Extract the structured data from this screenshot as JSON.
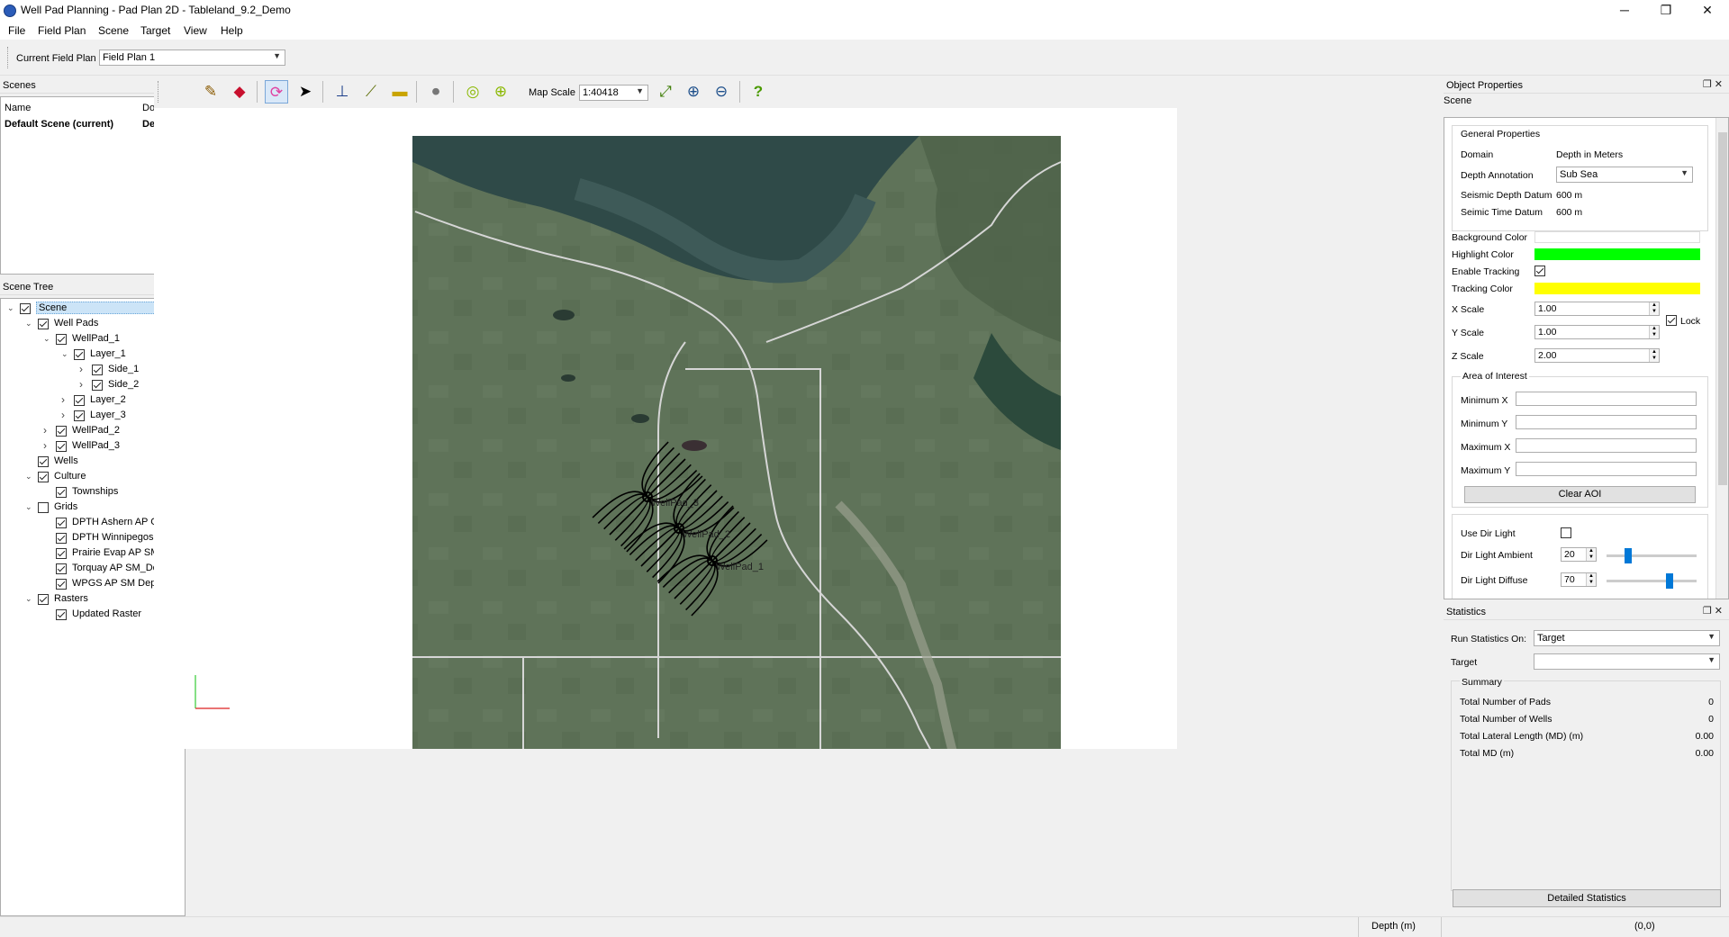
{
  "window": {
    "title": "Well Pad Planning - Pad Plan 2D - Tableland_9.2_Demo",
    "minimize": "─",
    "maximize": "❐",
    "close": "✕"
  },
  "menu": [
    "File",
    "Field Plan",
    "Scene",
    "Target",
    "View",
    "Help"
  ],
  "field_plan": {
    "label": "Current Field Plan",
    "value": "Field Plan 1"
  },
  "scenes_dock": {
    "title": "Scenes",
    "col_name": "Name",
    "col_domain": "Domain",
    "row_name": "Default Scene (current)",
    "row_domain": "Depth"
  },
  "scene_tree": {
    "title": "Scene Tree",
    "items": [
      {
        "label": "Scene",
        "depth": 0,
        "expanded": true,
        "checked": true,
        "selected": true
      },
      {
        "label": "Well Pads",
        "depth": 1,
        "expanded": true,
        "checked": true
      },
      {
        "label": "WellPad_1",
        "depth": 2,
        "expanded": true,
        "checked": true
      },
      {
        "label": "Layer_1",
        "depth": 3,
        "expanded": true,
        "checked": true
      },
      {
        "label": "Side_1",
        "depth": 4,
        "expanded": false,
        "checked": true,
        "hasChildren": true
      },
      {
        "label": "Side_2",
        "depth": 4,
        "expanded": false,
        "checked": true,
        "hasChildren": true
      },
      {
        "label": "Layer_2",
        "depth": 3,
        "expanded": false,
        "checked": true,
        "hasChildren": true
      },
      {
        "label": "Layer_3",
        "depth": 3,
        "expanded": false,
        "checked": true,
        "hasChildren": true
      },
      {
        "label": "WellPad_2",
        "depth": 2,
        "expanded": false,
        "checked": true,
        "hasChildren": true
      },
      {
        "label": "WellPad_3",
        "depth": 2,
        "expanded": false,
        "checked": true,
        "hasChildren": true
      },
      {
        "label": "Wells",
        "depth": 1,
        "checked": true
      },
      {
        "label": "Culture",
        "depth": 1,
        "expanded": true,
        "checked": true
      },
      {
        "label": "Townships",
        "depth": 2,
        "checked": true
      },
      {
        "label": "Grids",
        "depth": 1,
        "expanded": true,
        "checked": false
      },
      {
        "label": "DPTH Ashern AP Grid",
        "depth": 2,
        "checked": true
      },
      {
        "label": "DPTH Winnipegosis ...",
        "depth": 2,
        "checked": true
      },
      {
        "label": "Prairie Evap AP SM ...",
        "depth": 2,
        "checked": true
      },
      {
        "label": "Torquay AP SM_Dep...",
        "depth": 2,
        "checked": true
      },
      {
        "label": "WPGS AP SM Depth ...",
        "depth": 2,
        "checked": true
      },
      {
        "label": "Rasters",
        "depth": 1,
        "expanded": true,
        "checked": true
      },
      {
        "label": "Updated Raster",
        "depth": 2,
        "checked": true
      }
    ]
  },
  "toolbar": {
    "map_scale_label": "Map Scale",
    "map_scale_value": "1:40418",
    "help": "?"
  },
  "map": {
    "pads": [
      {
        "label": "WellPad_3"
      },
      {
        "label": "WellPad_2"
      },
      {
        "label": "WellPad_1"
      }
    ]
  },
  "object_properties": {
    "title": "Object Properties",
    "subtitle": "Scene",
    "general_title": "General Properties",
    "domain_label": "Domain",
    "domain_value": "Depth in Meters",
    "depth_annotation_label": "Depth Annotation",
    "depth_annotation_value": "Sub Sea",
    "seismic_depth_label": "Seismic Depth Datum",
    "seismic_depth_value": "600 m",
    "seismic_time_label": "Seimic Time Datum",
    "seismic_time_value": "600 m",
    "bg_color_label": "Background Color",
    "bg_color": "#ffffff",
    "highlight_color_label": "Highlight Color",
    "highlight_color": "#00ff00",
    "enable_tracking_label": "Enable Tracking",
    "tracking_color_label": "Tracking Color",
    "tracking_color": "#ffff00",
    "x_scale_label": "X Scale",
    "x_scale": "1.00",
    "y_scale_label": "Y Scale",
    "y_scale": "1.00",
    "z_scale_label": "Z Scale",
    "z_scale": "2.00",
    "lock_label": "Lock",
    "aoi_title": "Area of Interest",
    "min_x_label": "Minimum X",
    "min_y_label": "Minimum Y",
    "max_x_label": "Maximum X",
    "max_y_label": "Maximum Y",
    "clear_aoi": "Clear AOI",
    "use_dir_light_label": "Use Dir Light",
    "dir_ambient_label": "Dir Light Ambient",
    "dir_ambient_value": "20",
    "dir_diffuse_label": "Dir Light Diffuse",
    "dir_diffuse_value": "70"
  },
  "statistics": {
    "title": "Statistics",
    "run_on_label": "Run Statistics On:",
    "run_on_value": "Target",
    "target_label": "Target",
    "summary_title": "Summary",
    "rows": [
      {
        "label": "Total Number of Pads",
        "value": "0"
      },
      {
        "label": "Total Number of Wells",
        "value": "0"
      },
      {
        "label": "Total Lateral Length (MD) (m)",
        "value": "0.00"
      },
      {
        "label": "Total MD (m)",
        "value": "0.00"
      }
    ],
    "detailed_button": "Detailed Statistics"
  },
  "status": {
    "depth": "Depth (m)",
    "coords": "(0,0)"
  }
}
